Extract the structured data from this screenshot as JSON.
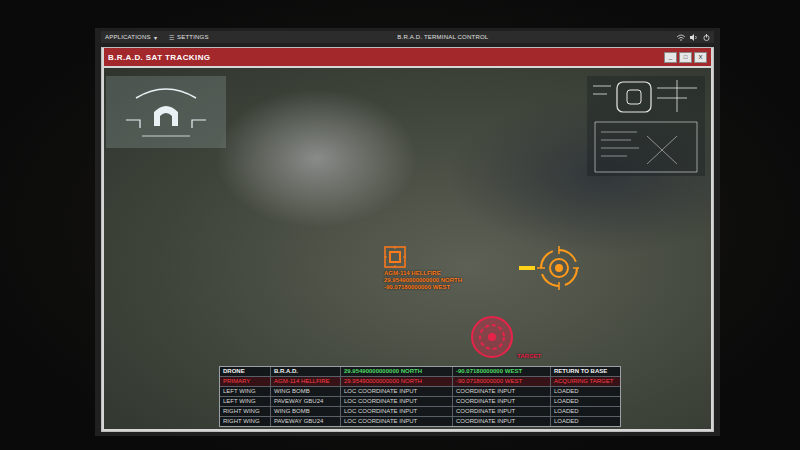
{
  "system_bar": {
    "menus": [
      {
        "label": "APPLICATIONS",
        "icon": "▾"
      },
      {
        "label": "SETTINGS",
        "icon": "☰"
      }
    ],
    "title": "B.R.A.D. TERMINAL CONTROL"
  },
  "window": {
    "title": "B.R.A.D. SAT TRACKING",
    "controls": [
      "_",
      "□",
      "X"
    ]
  },
  "markers": [
    {
      "kind": "weapon",
      "lines": [
        "AGM-114 HELLFIRE",
        "29.95490000000000 NORTH",
        "-90.07180000000 WEST"
      ],
      "color": "#ff7a1a"
    },
    {
      "kind": "crosshair",
      "lines": [],
      "color": "#ff9a1a"
    },
    {
      "kind": "target",
      "lines": [
        "TARGET"
      ],
      "color": "#e8234a"
    }
  ],
  "table": {
    "columns": [
      {
        "label": "DRONE",
        "color": "#f2f2f2"
      },
      {
        "label": "B.R.A.D.",
        "color": "#f2f2f2"
      },
      {
        "label": "29.95490000000000 NORTH",
        "color": "#4cd964"
      },
      {
        "label": "-90.07180000000 WEST",
        "color": "#4cd964"
      },
      {
        "label": "RETURN TO BASE",
        "color": "#f2f2f2"
      }
    ],
    "rows": [
      {
        "cells": [
          "PRIMARY",
          "AGM-114 HELLFIRE",
          "29.95490000000000 NORTH",
          "-90.07180000000 WEST",
          "ACQUIRING TARGET"
        ],
        "selected": true
      },
      {
        "cells": [
          "LEFT WING",
          "WING BOMB",
          "LOC COORDINATE INPUT",
          "COORDINATE INPUT",
          "LOADED"
        ],
        "selected": false
      },
      {
        "cells": [
          "LEFT WING",
          "PAVEWAY GBU24",
          "LOC COORDINATE INPUT",
          "COORDINATE INPUT",
          "LOADED"
        ],
        "selected": false
      },
      {
        "cells": [
          "RIGHT WING",
          "WING BOMB",
          "LOC COORDINATE INPUT",
          "COORDINATE INPUT",
          "LOADED"
        ],
        "selected": false
      },
      {
        "cells": [
          "RIGHT WING",
          "PAVEWAY GBU24",
          "LOC COORDINATE INPUT",
          "COORDINATE INPUT",
          "LOADED"
        ],
        "selected": false
      }
    ]
  }
}
